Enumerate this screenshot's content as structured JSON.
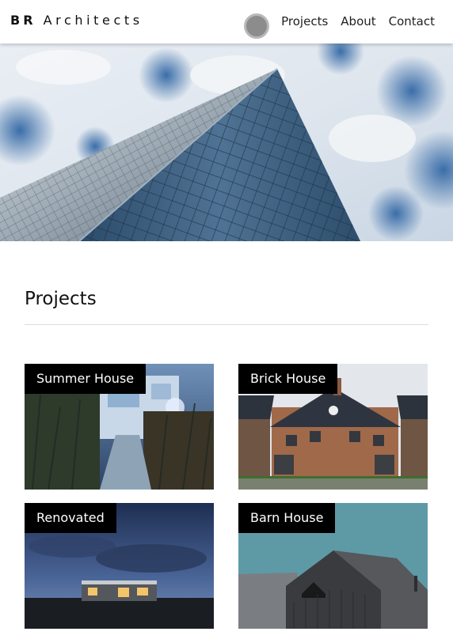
{
  "header": {
    "brand_initials": "BR",
    "brand_rest": "Architects",
    "nav": [
      "Projects",
      "About",
      "Contact"
    ]
  },
  "section": {
    "title": "Projects"
  },
  "projects": [
    {
      "label": "Summer House"
    },
    {
      "label": "Brick House"
    },
    {
      "label": "Renovated"
    },
    {
      "label": "Barn House"
    }
  ]
}
